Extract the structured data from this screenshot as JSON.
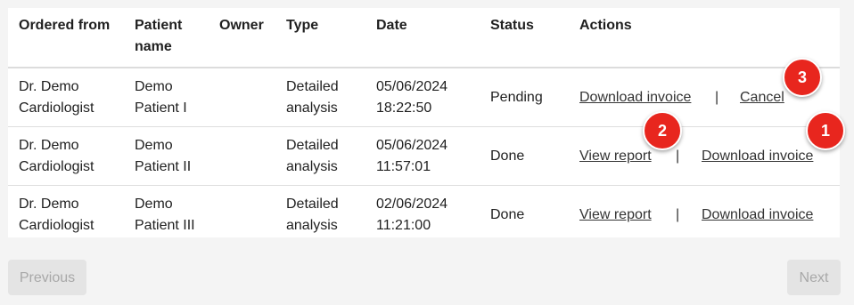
{
  "table": {
    "headers": {
      "ordered_from": "Ordered from",
      "patient_name_1": "Patient",
      "patient_name_2": "name",
      "owner": "Owner",
      "type": "Type",
      "date": "Date",
      "status": "Status",
      "actions": "Actions"
    },
    "rows": [
      {
        "ordered_from_1": "Dr. Demo",
        "ordered_from_2": "Cardiologist",
        "patient_1": "Demo",
        "patient_2": "Patient I",
        "owner": "",
        "type_1": "Detailed",
        "type_2": "analysis",
        "date_1": "05/06/2024",
        "date_2": "18:22:50",
        "status": "Pending",
        "action_1": "Download invoice",
        "separator": "|",
        "action_2": "Cancel"
      },
      {
        "ordered_from_1": "Dr. Demo",
        "ordered_from_2": "Cardiologist",
        "patient_1": "Demo",
        "patient_2": "Patient II",
        "owner": "",
        "type_1": "Detailed",
        "type_2": "analysis",
        "date_1": "05/06/2024",
        "date_2": "11:57:01",
        "status": "Done",
        "action_1": "View report",
        "separator": "|",
        "action_2": "Download invoice"
      },
      {
        "ordered_from_1": "Dr. Demo",
        "ordered_from_2": "Cardiologist",
        "patient_1": "Demo",
        "patient_2": "Patient III",
        "owner": "",
        "type_1": "Detailed",
        "type_2": "analysis",
        "date_1": "02/06/2024",
        "date_2": "11:21:00",
        "status": "Done",
        "action_1": "View report",
        "separator": "|",
        "action_2": "Download invoice"
      }
    ]
  },
  "annotations": {
    "badge_1": "1",
    "badge_2": "2",
    "badge_3": "3"
  },
  "pagination": {
    "previous_label": "Previous",
    "next_label": "Next"
  },
  "colors": {
    "badge": "#e8261e",
    "background": "#f4f4f4",
    "card": "#ffffff"
  }
}
